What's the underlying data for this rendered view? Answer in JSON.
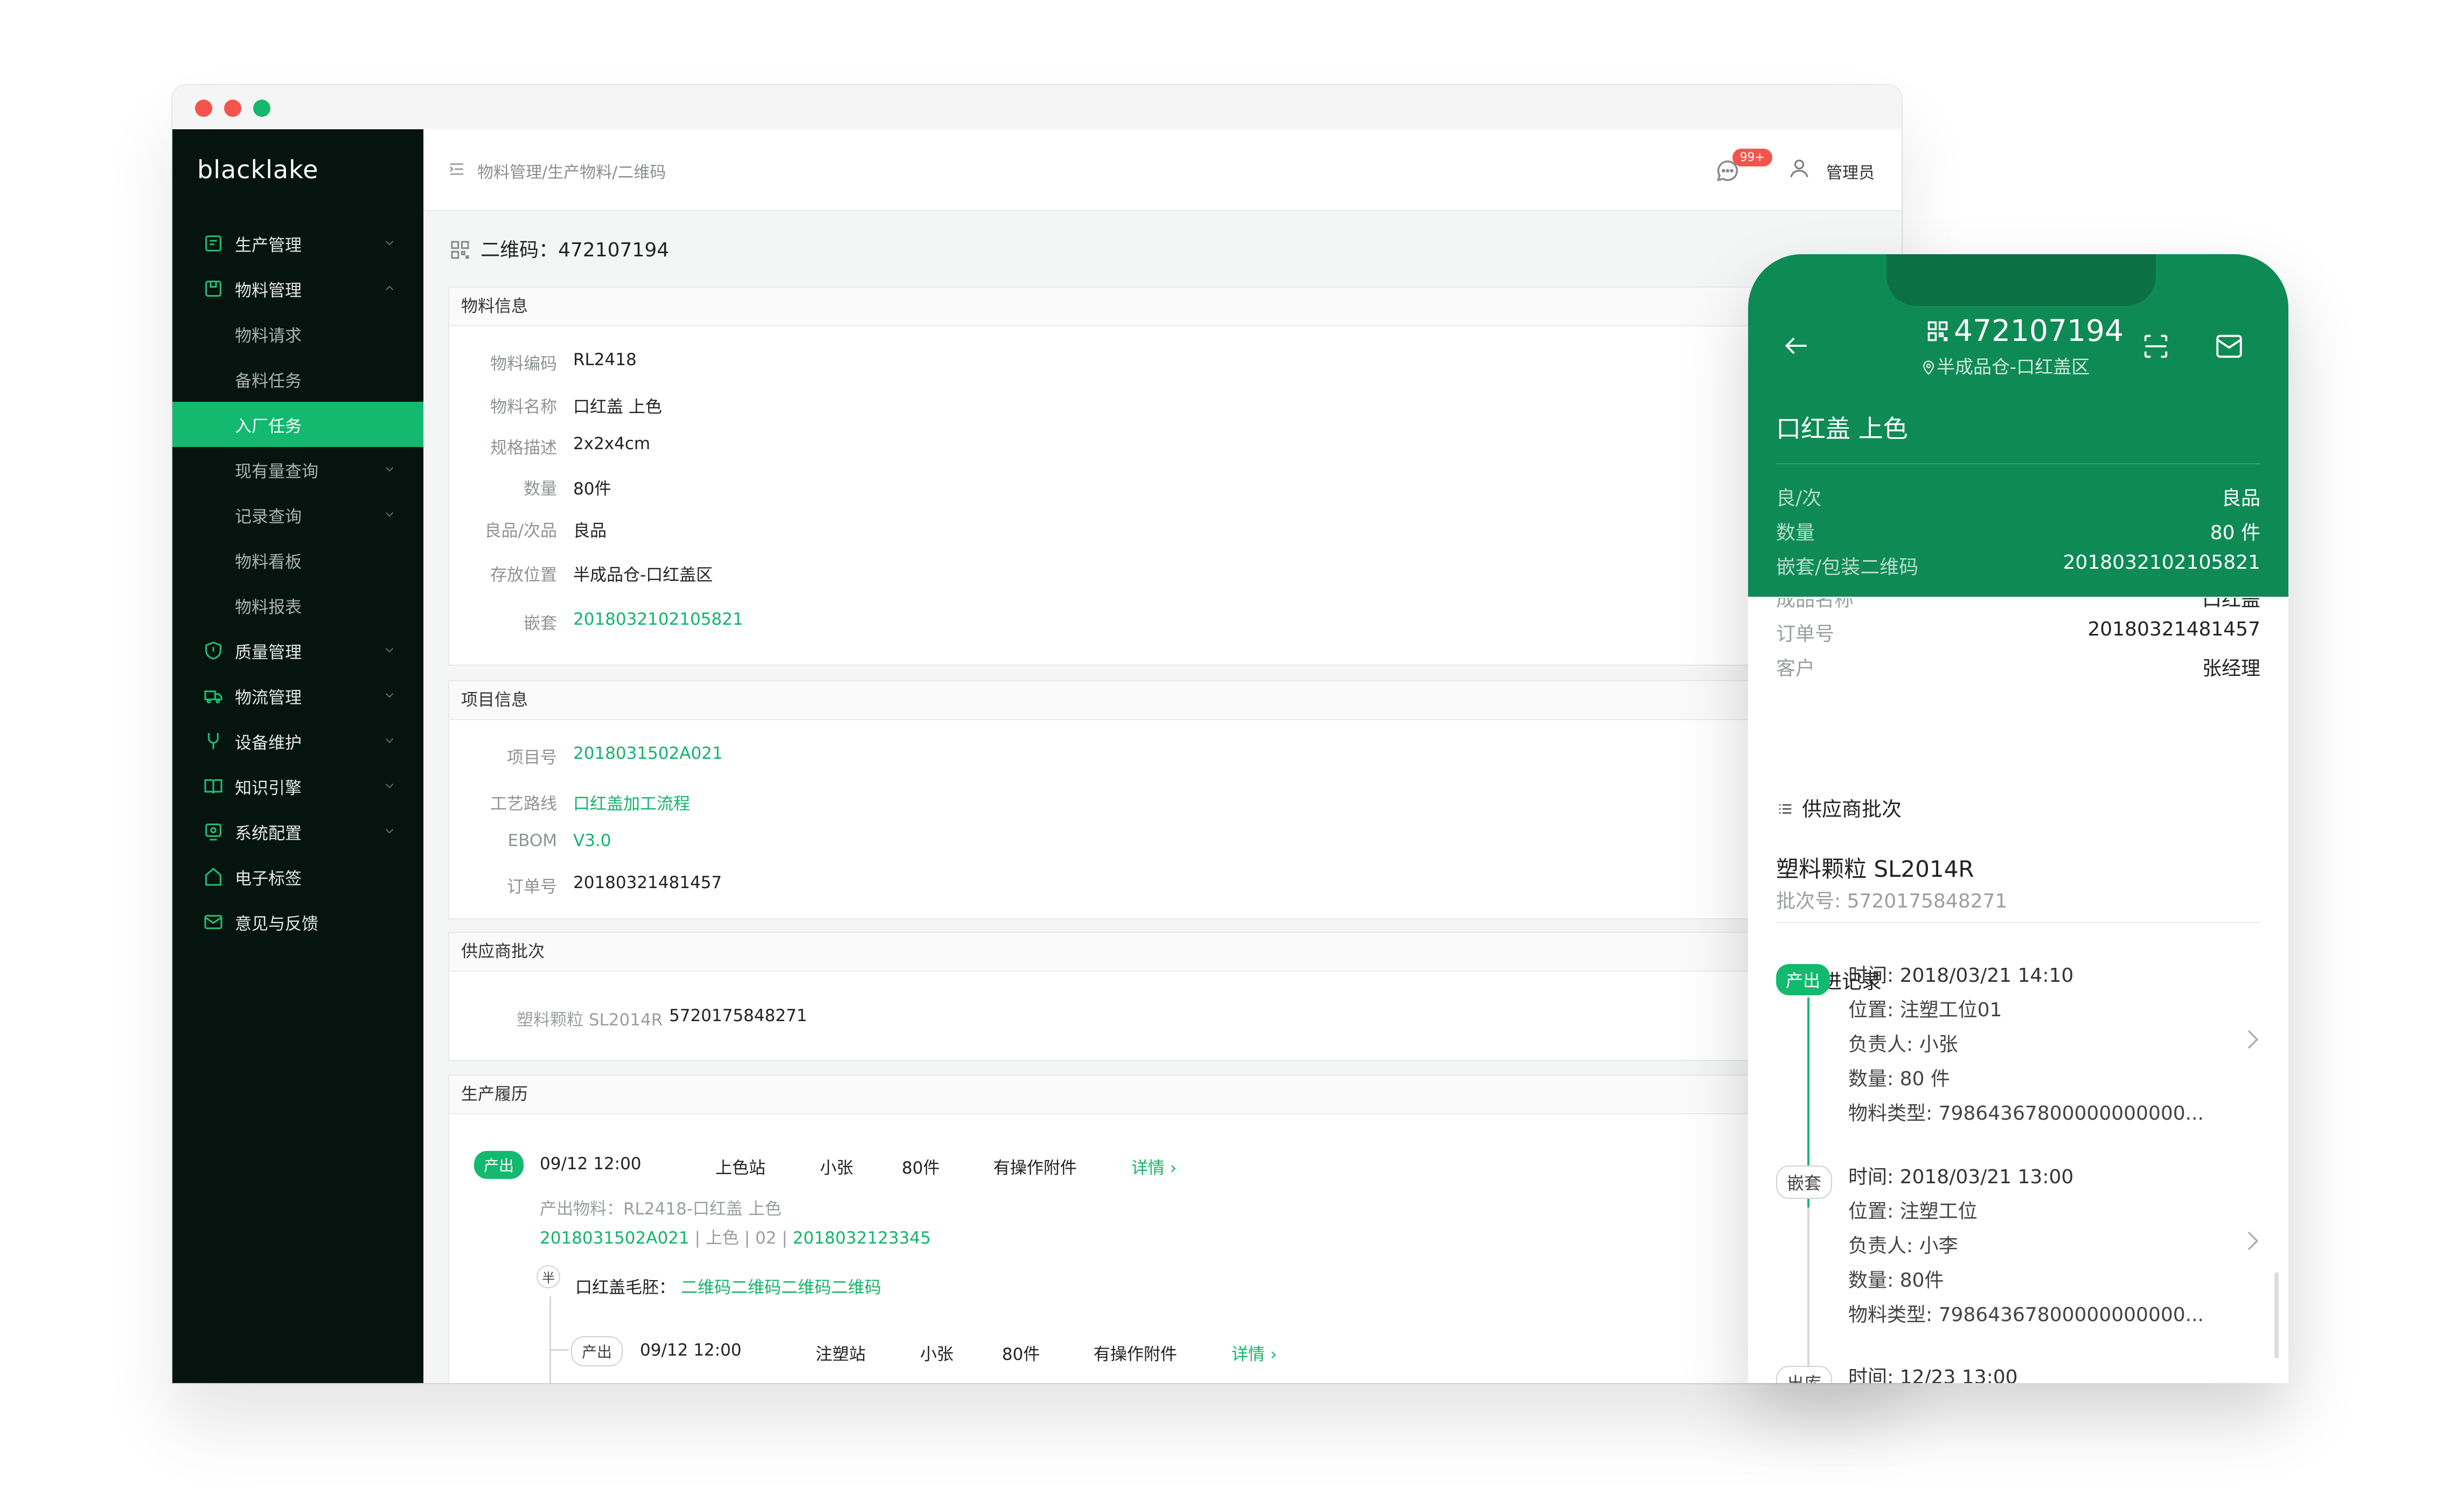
{
  "sidebar": {
    "brand": "blacklake",
    "items": [
      {
        "label": "生产管理",
        "icon": "production-icon",
        "chevron": "down"
      },
      {
        "label": "物料管理",
        "icon": "material-icon",
        "chevron": "up"
      },
      {
        "label": "物料请求",
        "sub": true
      },
      {
        "label": "备料任务",
        "sub": true
      },
      {
        "label": "入厂任务",
        "sub": true,
        "active": true
      },
      {
        "label": "现有量查询",
        "sub": true,
        "chevron": "down"
      },
      {
        "label": "记录查询",
        "sub": true,
        "chevron": "down"
      },
      {
        "label": "物料看板",
        "sub": true
      },
      {
        "label": "物料报表",
        "sub": true
      },
      {
        "label": "质量管理",
        "icon": "quality-icon",
        "chevron": "down"
      },
      {
        "label": "物流管理",
        "icon": "logistics-icon",
        "chevron": "down"
      },
      {
        "label": "设备维护",
        "icon": "equipment-icon",
        "chevron": "down"
      },
      {
        "label": "知识引擎",
        "icon": "knowledge-icon",
        "chevron": "down"
      },
      {
        "label": "系统配置",
        "icon": "settings-icon",
        "chevron": "down"
      },
      {
        "label": "电子标签",
        "icon": "tag-icon"
      },
      {
        "label": "意见与反馈",
        "icon": "feedback-icon"
      }
    ]
  },
  "header": {
    "breadcrumb": "物料管理/生产物料/二维码",
    "badge": "99+",
    "user": "管理员"
  },
  "page": {
    "title": "二维码：472107194"
  },
  "material_info": {
    "heading": "物料信息",
    "fields": [
      {
        "k": "物料编码",
        "v": "RL2418"
      },
      {
        "k": "物料名称",
        "v": "口红盖 上色"
      },
      {
        "k": "规格描述",
        "v": "2x2x4cm"
      },
      {
        "k": "数量",
        "v": "80件"
      },
      {
        "k": "良品/次品",
        "v": "良品"
      },
      {
        "k": "存放位置",
        "v": "半成品仓-口红盖区"
      },
      {
        "k": "嵌套",
        "v": "2018032102105821",
        "link": true
      }
    ]
  },
  "project_info": {
    "heading": "项目信息",
    "fields": [
      {
        "k": "项目号",
        "v": "2018031502A021",
        "link": true
      },
      {
        "k": "工艺路线",
        "v": "口红盖加工流程",
        "link": true
      },
      {
        "k": "EBOM",
        "v": "V3.0",
        "link": true
      },
      {
        "k": "订单号",
        "v": "20180321481457"
      }
    ]
  },
  "supplier_batch": {
    "heading": "供应商批次",
    "name": "塑料颗粒 SL2014R",
    "batch": "5720175848271"
  },
  "history": {
    "heading": "生产履历",
    "row1": {
      "tag": "产出",
      "time": "09/12 12:00",
      "station": "上色站",
      "person": "小张",
      "qty": "80件",
      "attach": "有操作附件",
      "detail": "详情 ›"
    },
    "material_line": "产出物料：RL2418-口红盖 上色",
    "material_link1": "2018031502A021",
    "material_mid": " | 上色 | 02 | ",
    "material_link2": "2018032123345",
    "semi_tag": "半",
    "semi_label": "口红盖毛胚：",
    "semi_link": "二维码二维码二维码二维码",
    "row2": {
      "tag": "产出",
      "time": "09/12 12:00",
      "station": "注塑站",
      "person": "小张",
      "qty": "80件",
      "attach": "有操作附件",
      "detail": "详情 ›"
    }
  },
  "phone": {
    "code": "472107194",
    "location": "半成品仓-口红盖区",
    "name": "口红盖 上色",
    "top_fields": [
      {
        "k": "良/次",
        "v": "良品"
      },
      {
        "k": "数量",
        "v": "80 件"
      },
      {
        "k": "嵌套/包装二维码",
        "v": "2018032102105821"
      }
    ],
    "partial_field": {
      "k": "成品名称",
      "v": "口红盖"
    },
    "fields": [
      {
        "k": "订单号",
        "v": "20180321481457"
      },
      {
        "k": "客户",
        "v": "张经理"
      }
    ],
    "supplier_heading": "供应商批次",
    "supplier_name": "塑料颗粒 SL2014R",
    "supplier_batch": "批次号: 5720175848271",
    "track_heading": "跟进记录",
    "records": [
      {
        "tag": "产出",
        "time": "时间:  2018/03/21 14:10",
        "pos": "位置:  注塑工位01",
        "owner": "负责人:  小张",
        "qty": "数量:  80 件",
        "type": "物料类型:  79864367800000000000..."
      },
      {
        "tag": "嵌套",
        "time": "时间:  2018/03/21 13:00",
        "pos": "位置:  注塑工位",
        "owner": "负责人:  小李",
        "qty": "数量:  80件",
        "type": "物料类型:  79864367800000000000..."
      },
      {
        "tag": "出库",
        "time": "时间:  12/23 13:00"
      }
    ]
  },
  "colors": {
    "accent": "#12b96e",
    "phone_header": "#0e8a55",
    "sidebar": "#06140f"
  }
}
